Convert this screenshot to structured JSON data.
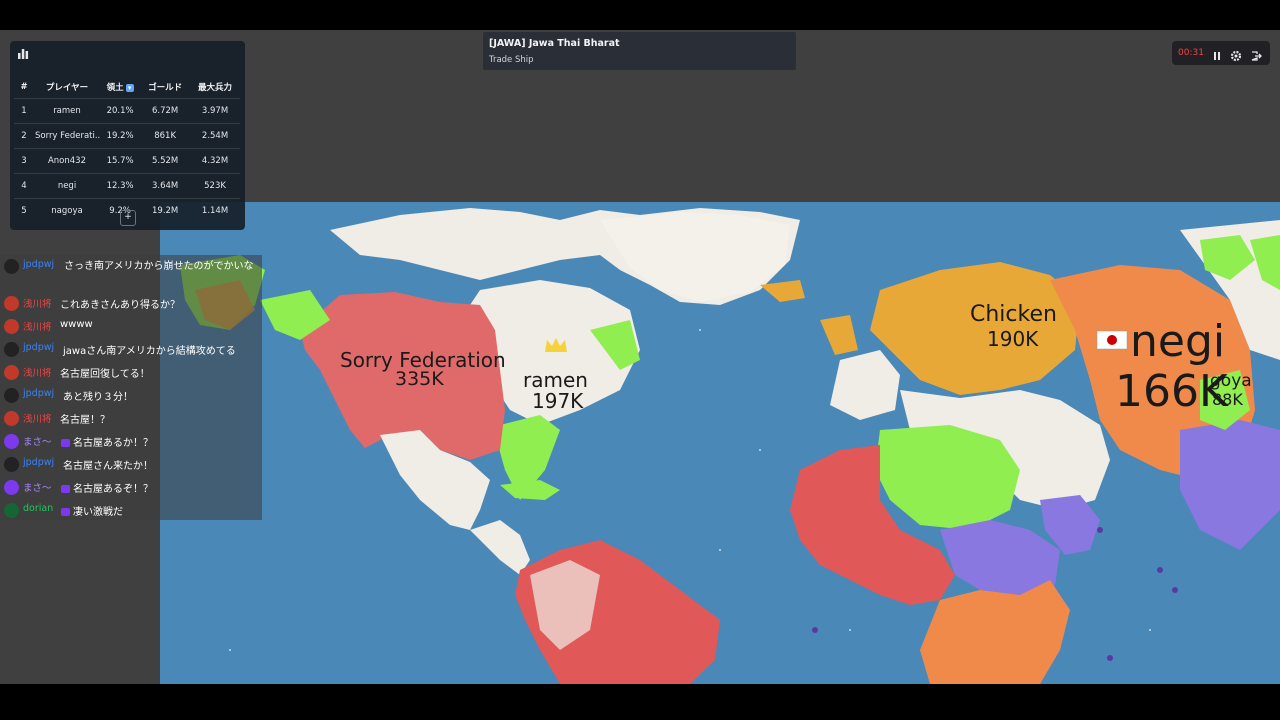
{
  "leaderboard": {
    "headers": [
      "#",
      "プレイヤー",
      "領土",
      "ゴールド",
      "最大兵力"
    ],
    "rows": [
      {
        "rank": "1",
        "name": "ramen",
        "territory": "20.1%",
        "gold": "6.72M",
        "troops": "3.97M"
      },
      {
        "rank": "2",
        "name": "Sorry Federati...",
        "territory": "19.2%",
        "gold": "861K",
        "troops": "2.54M"
      },
      {
        "rank": "3",
        "name": "Anon432",
        "territory": "15.7%",
        "gold": "5.52M",
        "troops": "4.32M"
      },
      {
        "rank": "4",
        "name": "negi",
        "territory": "12.3%",
        "gold": "3.64M",
        "troops": "523K"
      },
      {
        "rank": "5",
        "name": "nagoya",
        "territory": "9.2%",
        "gold": "19.2M",
        "troops": "1.14M"
      }
    ],
    "expand_label": "+"
  },
  "event": {
    "title": "[JAWA] Jawa Thai Bharat",
    "subtitle": "Trade Ship"
  },
  "controls": {
    "timer": "00:31"
  },
  "chat": [
    {
      "user": "jpdpwj",
      "msg": "さっき南アメリカから崩せたのがでかいな",
      "user_color": "#3b82f6",
      "avatar": "#222"
    },
    {
      "user": "浅川将",
      "msg": "これあきさんあり得るか？",
      "user_color": "#ef4444",
      "avatar": "#c0392b"
    },
    {
      "user": "浅川将",
      "msg": "wwww",
      "user_color": "#ef4444",
      "avatar": "#c0392b"
    },
    {
      "user": "jpdpwj",
      "msg": "jawaさん南アメリカから結構攻めてる",
      "user_color": "#3b82f6",
      "avatar": "#222"
    },
    {
      "user": "浅川将",
      "msg": "名古屋回復してる！",
      "user_color": "#ef4444",
      "avatar": "#c0392b"
    },
    {
      "user": "jpdpwj",
      "msg": "あと残り３分！",
      "user_color": "#3b82f6",
      "avatar": "#222"
    },
    {
      "user": "浅川将",
      "msg": "名古屋！？",
      "user_color": "#ef4444",
      "avatar": "#c0392b"
    },
    {
      "user": "まさ〜",
      "msg": "名古屋あるか！？",
      "user_color": "#a78bfa",
      "avatar": "#7c3aed"
    },
    {
      "user": "jpdpwj",
      "msg": "名古屋さん来たか！",
      "user_color": "#3b82f6",
      "avatar": "#222"
    },
    {
      "user": "まさ〜",
      "msg": "名古屋あるぞ！？",
      "user_color": "#a78bfa",
      "avatar": "#7c3aed"
    },
    {
      "user": "dorian",
      "msg": "凄い激戦だ",
      "user_color": "#22c55e",
      "avatar": "#166534"
    }
  ],
  "map_labels": {
    "sorry_name": "Sorry Federation",
    "sorry_troops": "335K",
    "ramen_name": "ramen",
    "ramen_troops": "197K",
    "chicken_name": "Chicken",
    "chicken_troops": "190K",
    "negi_name": "negi",
    "negi_troops": "166K",
    "nagoya_name": "goya",
    "nagoya_troops": "88K"
  },
  "colors": {
    "ocean": "#4a88b8",
    "sorry_federation": "#e06a6a",
    "ramen": "#f0ece6",
    "chicken": "#e8a838",
    "negi": "#f08a4a",
    "green_player": "#90ee50",
    "purple_player": "#8878e0",
    "jawa": "#e05858"
  }
}
